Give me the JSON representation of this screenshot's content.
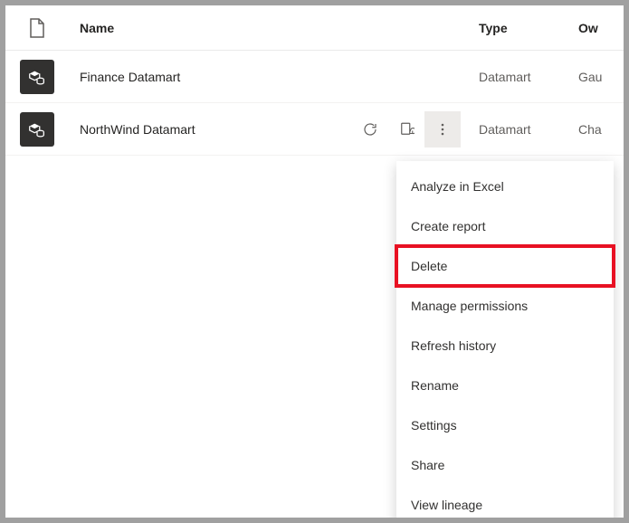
{
  "columns": {
    "name": "Name",
    "type": "Type",
    "owner": "Ow"
  },
  "rows": [
    {
      "name": "Finance Datamart",
      "type": "Datamart",
      "owner": "Gau",
      "showActions": false
    },
    {
      "name": "NorthWind Datamart",
      "type": "Datamart",
      "owner": "Cha",
      "showActions": true
    }
  ],
  "menu": {
    "items": [
      {
        "label": "Analyze in Excel"
      },
      {
        "label": "Create report"
      },
      {
        "label": "Delete",
        "highlighted": true
      },
      {
        "label": "Manage permissions"
      },
      {
        "label": "Refresh history"
      },
      {
        "label": "Rename"
      },
      {
        "label": "Settings"
      },
      {
        "label": "Share"
      },
      {
        "label": "View lineage"
      }
    ]
  }
}
